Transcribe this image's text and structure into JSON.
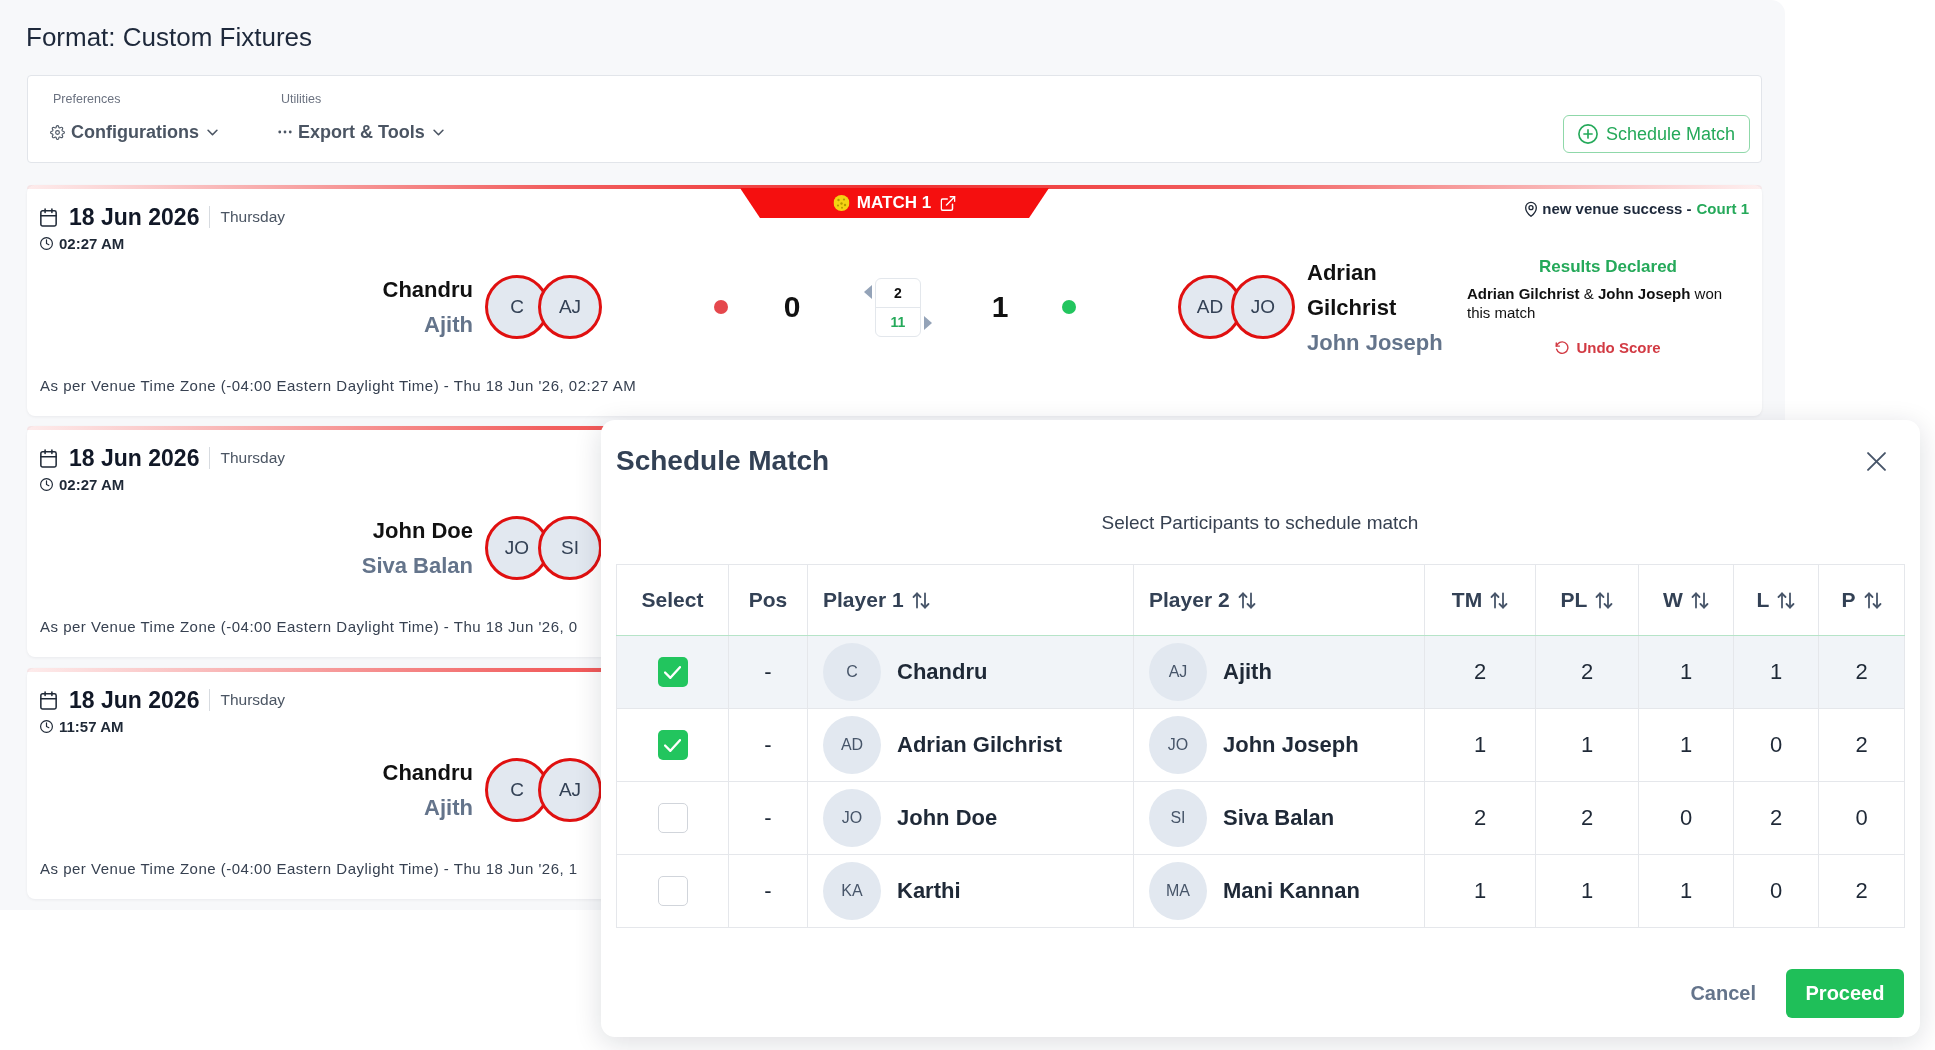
{
  "page_title": "Format: Custom Fixtures",
  "toolbar": {
    "groups": [
      {
        "label": "Preferences",
        "menu": "Configurations",
        "kind": "settings"
      },
      {
        "label": "Utilities",
        "menu": "Export & Tools",
        "kind": "more"
      }
    ],
    "action": "Schedule Match"
  },
  "matches": [
    {
      "badge": "MATCH 1",
      "date": "18 Jun 2026",
      "weekday": "Thursday",
      "time": "02:27 AM",
      "venue": "new venue success -",
      "court": "Court 1",
      "teams": [
        {
          "players": [
            {
              "name": "Chandru",
              "initials": "C"
            },
            {
              "name": "Ajith",
              "initials": "AJ"
            }
          ],
          "score": "0",
          "color": "#e5484d"
        },
        {
          "players": [
            {
              "name": "Adrian Gilchrist",
              "initials": "AD"
            },
            {
              "name": "John Joseph",
              "initials": "JO"
            }
          ],
          "score": "1",
          "color": "#22c55e"
        }
      ],
      "score_box": {
        "upper": "2",
        "lower": "11"
      },
      "result": {
        "status": "Results Declared",
        "text": "**Adrian Gilchrist** & **John Joseph** won this match",
        "action": "Undo Score"
      },
      "timezone_note": "As per Venue Time Zone (-04:00 Eastern Daylight Time) - Thu 18 Jun '26, 02:27 AM"
    },
    {
      "date": "18 Jun 2026",
      "weekday": "Thursday",
      "time": "02:27 AM",
      "teams": [
        {
          "players": [
            {
              "name": "John Doe",
              "initials": "JO"
            },
            {
              "name": "Siva Balan",
              "initials": "SI"
            }
          ]
        }
      ],
      "timezone_note": "As per Venue Time Zone (-04:00 Eastern Daylight Time) - Thu 18 Jun '26, 0"
    },
    {
      "date": "18 Jun 2026",
      "weekday": "Thursday",
      "time": "11:57 AM",
      "teams": [
        {
          "players": [
            {
              "name": "Chandru",
              "initials": "C"
            },
            {
              "name": "Ajith",
              "initials": "AJ"
            }
          ]
        }
      ],
      "timezone_note": "As per Venue Time Zone (-04:00 Eastern Daylight Time) - Thu 18 Jun '26, 1"
    }
  ],
  "modal": {
    "title": "Schedule Match",
    "subtitle": "Select Participants to schedule match",
    "columns": [
      {
        "label": "Select",
        "sortable": false
      },
      {
        "label": "Pos",
        "sortable": false
      },
      {
        "label": "Player 1",
        "sortable": true
      },
      {
        "label": "Player 2",
        "sortable": true
      },
      {
        "label": "TM",
        "sortable": true
      },
      {
        "label": "PL",
        "sortable": true
      },
      {
        "label": "W",
        "sortable": true
      },
      {
        "label": "L",
        "sortable": true
      },
      {
        "label": "P",
        "sortable": true
      }
    ],
    "rows": [
      {
        "checked": true,
        "hovered": true,
        "pos": "-",
        "player_1": {
          "initials": "C",
          "name": "Chandru"
        },
        "player_2": {
          "initials": "AJ",
          "name": "Ajith"
        },
        "stats": [
          "2",
          "2",
          "1",
          "1",
          "2"
        ]
      },
      {
        "checked": true,
        "hovered": false,
        "pos": "-",
        "player_1": {
          "initials": "AD",
          "name": "Adrian Gilchrist"
        },
        "player_2": {
          "initials": "JO",
          "name": "John Joseph"
        },
        "stats": [
          "1",
          "1",
          "1",
          "0",
          "2"
        ]
      },
      {
        "checked": false,
        "hovered": false,
        "pos": "-",
        "player_1": {
          "initials": "JO",
          "name": "John Doe"
        },
        "player_2": {
          "initials": "SI",
          "name": "Siva Balan"
        },
        "stats": [
          "2",
          "2",
          "0",
          "2",
          "0"
        ]
      },
      {
        "checked": false,
        "hovered": false,
        "pos": "-",
        "player_1": {
          "initials": "KA",
          "name": "Karthi"
        },
        "player_2": {
          "initials": "MA",
          "name": "Mani Kannan"
        },
        "stats": [
          "1",
          "1",
          "1",
          "0",
          "2"
        ]
      }
    ],
    "buttons": [
      {
        "label": "Cancel",
        "kind": "secondary"
      },
      {
        "label": "Proceed",
        "kind": "primary"
      }
    ]
  }
}
